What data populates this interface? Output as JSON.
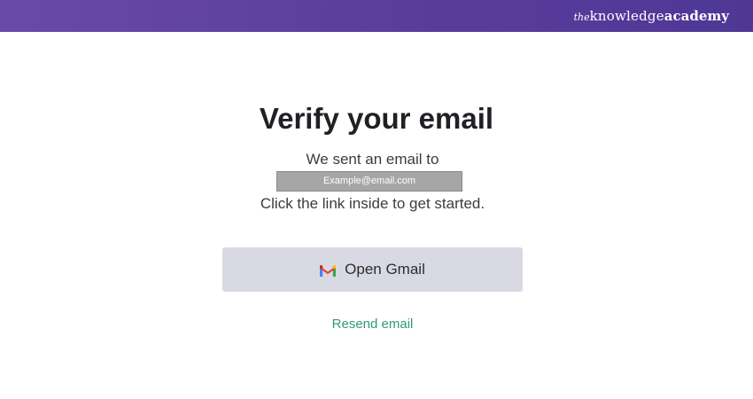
{
  "header": {
    "brand_the": "the",
    "brand_knowledge": "knowledge",
    "brand_academy": "academy",
    "bar_color_start": "#6a4aa8",
    "bar_color_end": "#4f3796"
  },
  "verify": {
    "title": "Verify your email",
    "sent_text": "We sent an email to",
    "email": "Example@email.com",
    "instruction": "Click the link inside to get started."
  },
  "actions": {
    "open_gmail_label": "Open Gmail",
    "open_gmail_icon": "gmail-icon",
    "resend_label": "Resend email",
    "link_color": "#2e9b76",
    "button_color": "#d9d9e3"
  }
}
